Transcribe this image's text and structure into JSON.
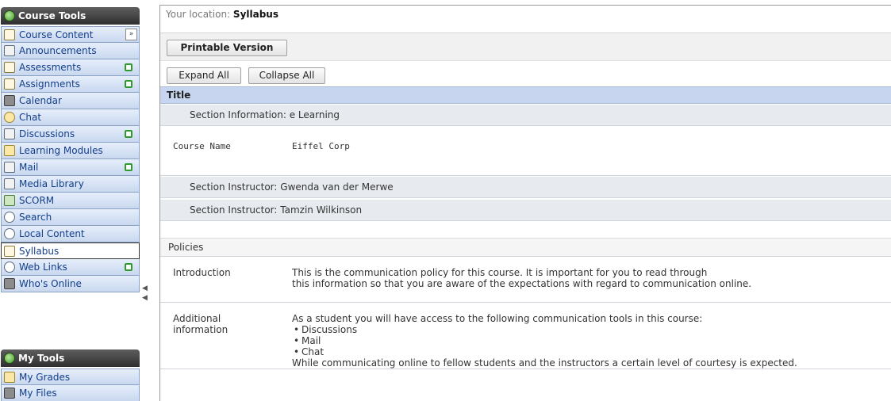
{
  "sidebar": {
    "course_tools_header": "Course Tools",
    "collapse_toggle": "»",
    "items": [
      {
        "label": "Course Content"
      },
      {
        "label": "Announcements"
      },
      {
        "label": "Assessments"
      },
      {
        "label": "Assignments"
      },
      {
        "label": "Calendar"
      },
      {
        "label": "Chat"
      },
      {
        "label": "Discussions"
      },
      {
        "label": "Learning Modules"
      },
      {
        "label": "Mail"
      },
      {
        "label": "Media Library"
      },
      {
        "label": "SCORM"
      },
      {
        "label": "Search"
      },
      {
        "label": "Local Content"
      },
      {
        "label": "Syllabus"
      },
      {
        "label": "Web Links"
      },
      {
        "label": "Who's Online"
      }
    ],
    "my_tools_header": "My Tools",
    "my_tools_items": [
      {
        "label": "My Grades"
      },
      {
        "label": "My Files"
      }
    ],
    "splitter_arrows": "◀\n◀"
  },
  "location": {
    "prefix": "Your location:",
    "current": "Syllabus"
  },
  "buttons": {
    "printable": "Printable Version",
    "expand_all": "Expand All",
    "collapse_all": "Collapse All"
  },
  "syllabus": {
    "title_header": "Title",
    "section_information": "Section Information: e Learning",
    "course_name_label": "Course Name",
    "course_name_value": "Eiffel Corp",
    "instructor_1": "Section Instructor: Gwenda van der Merwe",
    "instructor_2": "Section Instructor: Tamzin Wilkinson",
    "policies_header": "Policies",
    "introduction": {
      "label": "Introduction",
      "line1": "This is the communication policy for this course. It is important for you to read through",
      "line2": "this information so that you are aware of the expectations with regard to communication online."
    },
    "additional": {
      "label_line1": "Additional",
      "label_line2": "information",
      "intro": "As a student you will have access to the following communication tools in this course:",
      "tools": [
        "Discussions",
        "Mail",
        "Chat"
      ],
      "closing": "While communicating online to fellow students and the instructors a certain level of courtesy is expected."
    }
  }
}
